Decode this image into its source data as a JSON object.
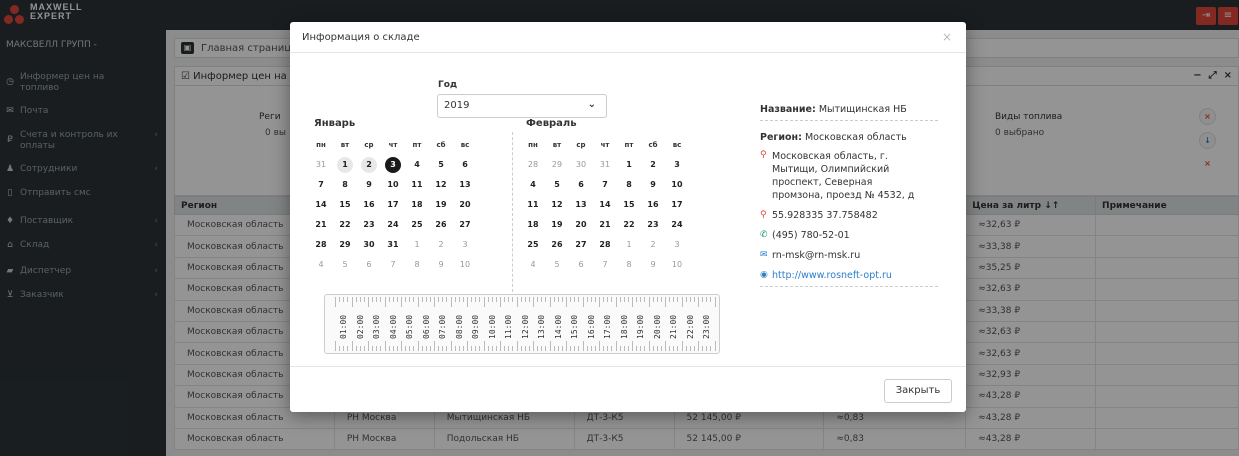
{
  "brand": {
    "line1": "MAXWELL",
    "line2": "EXPERT"
  },
  "sidebar": {
    "org": "МАКСВЕЛЛ ГРУПП -",
    "items": [
      {
        "label1": "Информер цен на",
        "label2": "топливо",
        "icon": "clock-icon",
        "chevron": ""
      },
      {
        "label1": "Почта",
        "label2": "",
        "icon": "envelope-icon",
        "chevron": ""
      },
      {
        "label1": "Счета и контроль их",
        "label2": "оплаты",
        "icon": "ruble-icon",
        "chevron": "‹"
      },
      {
        "label1": "Сотрудники",
        "label2": "",
        "icon": "user-icon",
        "chevron": "‹"
      },
      {
        "label1": "Отправить смс",
        "label2": "",
        "icon": "phone-icon",
        "chevron": ""
      },
      {
        "label1": "Поставщик",
        "label2": "",
        "icon": "drop-icon",
        "chevron": "‹"
      },
      {
        "label1": "Склад",
        "label2": "",
        "icon": "warehouse-icon",
        "chevron": "‹"
      },
      {
        "label1": "Диспетчер",
        "label2": "",
        "icon": "truck-icon",
        "chevron": "‹"
      },
      {
        "label1": "Заказчик",
        "label2": "",
        "icon": "cart-icon",
        "chevron": "‹"
      }
    ]
  },
  "breadcrumb": {
    "text": "Главная страниц"
  },
  "panel": {
    "title": "Информер цен на"
  },
  "filters": {
    "region_label": "Реги",
    "region_value": "0 вы",
    "fuel_label": "Виды топлива",
    "fuel_value": "0 выбрано"
  },
  "table": {
    "headers": [
      "Регион",
      "",
      "",
      "",
      "",
      "",
      "Цена за литр ↓↑",
      "Примечание"
    ],
    "rows": [
      [
        "Московская область",
        "",
        "",
        "",
        "",
        "",
        "≈32,63 ₽",
        ""
      ],
      [
        "Московская область",
        "",
        "",
        "",
        "",
        "",
        "≈33,38 ₽",
        ""
      ],
      [
        "Московская область",
        "",
        "",
        "",
        "",
        "",
        "≈35,25 ₽",
        ""
      ],
      [
        "Московская область",
        "",
        "",
        "",
        "",
        "",
        "≈32,63 ₽",
        ""
      ],
      [
        "Московская область",
        "",
        "",
        "",
        "",
        "",
        "≈33,38 ₽",
        ""
      ],
      [
        "Московская область",
        "",
        "",
        "",
        "",
        "",
        "≈32,63 ₽",
        ""
      ],
      [
        "Московская область",
        "",
        "",
        "",
        "",
        "",
        "≈32,63 ₽",
        ""
      ],
      [
        "Московская область",
        "",
        "",
        "",
        "",
        "",
        "≈32,93 ₽",
        ""
      ],
      [
        "Московская область",
        "",
        "",
        "",
        "",
        "",
        "≈43,28 ₽",
        ""
      ],
      [
        "Московская область",
        "РН Москва",
        "Мытищинская НБ",
        "ДТ-3-К5",
        "52 145,00 ₽",
        "≈0,83",
        "≈43,28 ₽",
        ""
      ],
      [
        "Московская область",
        "РН Москва",
        "Подольская НБ",
        "ДТ-3-К5",
        "52 145,00 ₽",
        "≈0,83",
        "≈43,28 ₽",
        ""
      ]
    ]
  },
  "modal": {
    "title": "Информация о складе",
    "close_x": "×",
    "year_label": "Год",
    "year_value": "2019",
    "weekdays": [
      "пн",
      "вт",
      "ср",
      "чт",
      "пт",
      "сб",
      "вс"
    ],
    "months": [
      {
        "name": "Январь",
        "weeks": [
          [
            {
              "d": "31",
              "t": "dim"
            },
            {
              "d": "1",
              "t": "hi"
            },
            {
              "d": "2",
              "t": "hi"
            },
            {
              "d": "3",
              "t": "sel"
            },
            {
              "d": "4"
            },
            {
              "d": "5"
            },
            {
              "d": "6"
            }
          ],
          [
            {
              "d": "7"
            },
            {
              "d": "8"
            },
            {
              "d": "9"
            },
            {
              "d": "10"
            },
            {
              "d": "11"
            },
            {
              "d": "12"
            },
            {
              "d": "13"
            }
          ],
          [
            {
              "d": "14"
            },
            {
              "d": "15"
            },
            {
              "d": "16"
            },
            {
              "d": "17"
            },
            {
              "d": "18"
            },
            {
              "d": "19"
            },
            {
              "d": "20"
            }
          ],
          [
            {
              "d": "21"
            },
            {
              "d": "22"
            },
            {
              "d": "23"
            },
            {
              "d": "24"
            },
            {
              "d": "25"
            },
            {
              "d": "26"
            },
            {
              "d": "27"
            }
          ],
          [
            {
              "d": "28"
            },
            {
              "d": "29"
            },
            {
              "d": "30"
            },
            {
              "d": "31"
            },
            {
              "d": "1",
              "t": "dim"
            },
            {
              "d": "2",
              "t": "dim"
            },
            {
              "d": "3",
              "t": "dim"
            }
          ],
          [
            {
              "d": "4",
              "t": "dim"
            },
            {
              "d": "5",
              "t": "dim"
            },
            {
              "d": "6",
              "t": "dim"
            },
            {
              "d": "7",
              "t": "dim"
            },
            {
              "d": "8",
              "t": "dim"
            },
            {
              "d": "9",
              "t": "dim"
            },
            {
              "d": "10",
              "t": "dim"
            }
          ]
        ]
      },
      {
        "name": "Февраль",
        "weeks": [
          [
            {
              "d": "28",
              "t": "dim"
            },
            {
              "d": "29",
              "t": "dim"
            },
            {
              "d": "30",
              "t": "dim"
            },
            {
              "d": "31",
              "t": "dim"
            },
            {
              "d": "1"
            },
            {
              "d": "2"
            },
            {
              "d": "3"
            }
          ],
          [
            {
              "d": "4"
            },
            {
              "d": "5"
            },
            {
              "d": "6"
            },
            {
              "d": "7"
            },
            {
              "d": "8"
            },
            {
              "d": "9"
            },
            {
              "d": "10"
            }
          ],
          [
            {
              "d": "11"
            },
            {
              "d": "12"
            },
            {
              "d": "13"
            },
            {
              "d": "14"
            },
            {
              "d": "15"
            },
            {
              "d": "16"
            },
            {
              "d": "17"
            }
          ],
          [
            {
              "d": "18"
            },
            {
              "d": "19"
            },
            {
              "d": "20"
            },
            {
              "d": "21"
            },
            {
              "d": "22"
            },
            {
              "d": "23"
            },
            {
              "d": "24"
            }
          ],
          [
            {
              "d": "25"
            },
            {
              "d": "26"
            },
            {
              "d": "27"
            },
            {
              "d": "28"
            },
            {
              "d": "1",
              "t": "dim"
            },
            {
              "d": "2",
              "t": "dim"
            },
            {
              "d": "3",
              "t": "dim"
            }
          ],
          [
            {
              "d": "4",
              "t": "dim"
            },
            {
              "d": "5",
              "t": "dim"
            },
            {
              "d": "6",
              "t": "dim"
            },
            {
              "d": "7",
              "t": "dim"
            },
            {
              "d": "8",
              "t": "dim"
            },
            {
              "d": "9",
              "t": "dim"
            },
            {
              "d": "10",
              "t": "dim"
            }
          ]
        ]
      }
    ],
    "hours": [
      "01:00",
      "02:00",
      "03:00",
      "04:00",
      "05:00",
      "06:00",
      "07:00",
      "08:00",
      "09:00",
      "10:00",
      "11:00",
      "12:00",
      "13:00",
      "14:00",
      "15:00",
      "16:00",
      "17:00",
      "18:00",
      "19:00",
      "20:00",
      "21:00",
      "22:00",
      "23:00"
    ],
    "info": {
      "name_label": "Название:",
      "name_value": "Мытищинская НБ",
      "region_label": "Регион:",
      "region_value": "Московская область",
      "address": [
        "Московская область, г.",
        "Мытищи, Олимпийский",
        "проспект, Северная",
        "промзона, проезд № 4532, д"
      ],
      "coords": "55.928335 37.758482",
      "phone": "(495) 780-52-01",
      "email": "rn-msk@rn-msk.ru",
      "site": "http://www.rosneft-opt.ru"
    },
    "close_button": "Закрыть"
  }
}
